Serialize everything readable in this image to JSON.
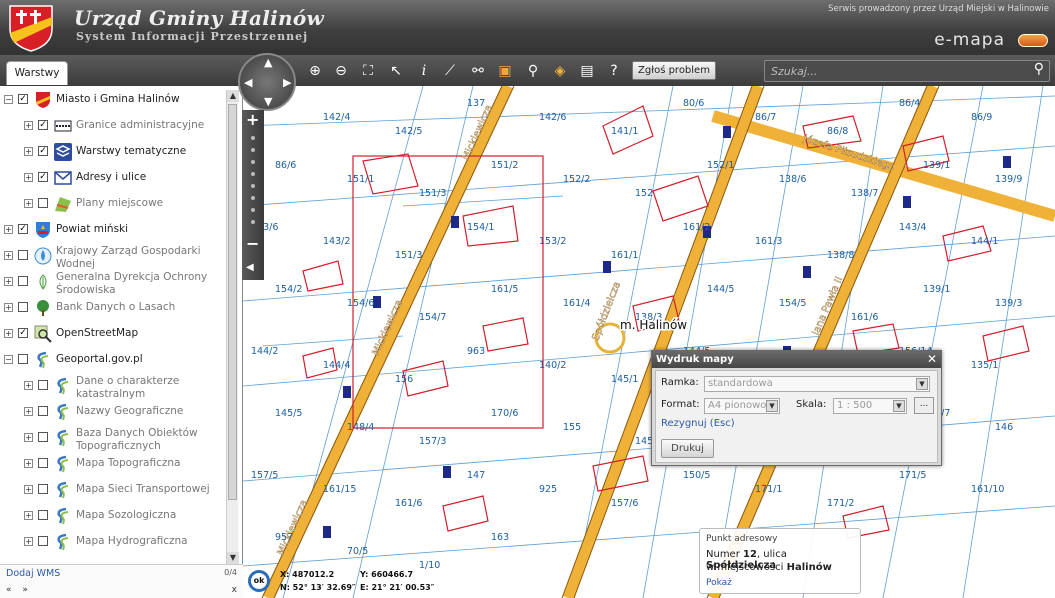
{
  "header": {
    "title": "Urząd Gminy Halinów",
    "subtitle": "System Informacji Przestrzennej",
    "service_note": "Serwis prowadzony przez Urząd Miejski w Halinowie",
    "brand": "e-mapa"
  },
  "toolbar": {
    "tab_label": "Warstwy",
    "report_button": "Zgłoś problem",
    "search_placeholder": "Szukaj..."
  },
  "sidebar": {
    "layers": [
      {
        "label": "Miasto i Gmina Halinów",
        "checked": true,
        "expand": "−",
        "indent": 0,
        "icon": "crest-icon",
        "dim": false
      },
      {
        "label": "Granice administracyjne",
        "checked": true,
        "expand": "+",
        "indent": 1,
        "icon": "boundary-icon",
        "dim": true
      },
      {
        "label": "Warstwy tematyczne",
        "checked": true,
        "expand": "+",
        "indent": 1,
        "icon": "layers-icon",
        "dim": false
      },
      {
        "label": "Adresy i ulice",
        "checked": true,
        "expand": "+",
        "indent": 1,
        "icon": "envelope-icon",
        "dim": false
      },
      {
        "label": "Plany miejscowe",
        "checked": false,
        "expand": "+",
        "indent": 1,
        "icon": "plan-icon",
        "dim": true
      },
      {
        "label": "Powiat miński",
        "checked": true,
        "expand": "+",
        "indent": 0,
        "icon": "county-crest-icon",
        "dim": false
      },
      {
        "label": "Krajowy Zarząd Gospodarki Wodnej",
        "checked": false,
        "expand": "+",
        "indent": 0,
        "icon": "water-icon",
        "dim": true
      },
      {
        "label": "Generalna Dyrekcja Ochrony Środowiska",
        "checked": false,
        "expand": "+",
        "indent": 0,
        "icon": "leaf-icon",
        "dim": true
      },
      {
        "label": "Bank Danych o Lasach",
        "checked": false,
        "expand": "+",
        "indent": 0,
        "icon": "tree-icon",
        "dim": true
      },
      {
        "label": "OpenStreetMap",
        "checked": true,
        "expand": "+",
        "indent": 0,
        "icon": "magnifier-map-icon",
        "dim": false
      },
      {
        "label": "Geoportal.gov.pl",
        "checked": false,
        "expand": "−",
        "indent": 0,
        "icon": "geoportal-icon",
        "dim": false
      },
      {
        "label": "Dane o charakterze katastralnym",
        "checked": false,
        "expand": "+",
        "indent": 1,
        "icon": "geoportal-icon",
        "dim": true
      },
      {
        "label": "Nazwy Geograficzne",
        "checked": false,
        "expand": "+",
        "indent": 1,
        "icon": "geoportal-icon",
        "dim": true
      },
      {
        "label": "Baza Danych Obiektów Topograficznych",
        "checked": false,
        "expand": "+",
        "indent": 1,
        "icon": "geoportal-icon",
        "dim": true
      },
      {
        "label": "Mapa Topograficzna",
        "checked": false,
        "expand": "+",
        "indent": 1,
        "icon": "geoportal-icon",
        "dim": true
      },
      {
        "label": "Mapa Sieci Transportowej",
        "checked": false,
        "expand": "+",
        "indent": 1,
        "icon": "geoportal-icon",
        "dim": true
      },
      {
        "label": "Mapa Sozologiczna",
        "checked": false,
        "expand": "+",
        "indent": 1,
        "icon": "geoportal-icon",
        "dim": true
      },
      {
        "label": "Mapa Hydrograficzna",
        "checked": false,
        "expand": "+",
        "indent": 1,
        "icon": "geoportal-icon",
        "dim": true
      }
    ],
    "add_wms": "Dodaj WMS",
    "wms_count": "0/4",
    "pager": "« »",
    "pager_close": "x"
  },
  "map": {
    "streets": [
      "Mickiewicza",
      "Mickiewicza",
      "Mickiewicza",
      "Józefa Piłsudskiego",
      "Spółdzielcza",
      "Jana Pawła II"
    ],
    "place_label": "m. Halinów",
    "parcels": [
      "136/3",
      "142/4",
      "142/5",
      "137",
      "142/6",
      "141/1",
      "80/6",
      "86/7",
      "86/8",
      "86/4",
      "86/9",
      "86/6",
      "151/1",
      "151/3",
      "151/2",
      "152/2",
      "152",
      "152/1",
      "138/6",
      "138/7",
      "139/1",
      "139/9",
      "143/6",
      "143/2",
      "151/3",
      "154/1",
      "153/2",
      "161/1",
      "161/2",
      "161/3",
      "138/8",
      "143/4",
      "144/1",
      "154/2",
      "154/6",
      "154/7",
      "161/5",
      "161/4",
      "138/3",
      "144/5",
      "154/5",
      "161/6",
      "139/1",
      "139/3",
      "144/2",
      "144/4",
      "156",
      "963",
      "140/2",
      "145/1",
      "144/5",
      "145/3",
      "145/2",
      "156/14",
      "135/1",
      "145/5",
      "148/4",
      "157/3",
      "170/6",
      "155",
      "145/6",
      "157/4",
      "161/14",
      "161/13",
      "170/7",
      "146",
      "157/5",
      "161/15",
      "161/6",
      "147",
      "925",
      "157/6",
      "150/5",
      "171/1",
      "171/2",
      "171/5",
      "161/10",
      "957",
      "70/5",
      "1/10",
      "163"
    ],
    "coords_x": "X: 487012.2",
    "coords_y": "Y: 660466.7",
    "coords_n": "N: 52° 13′ 32.69″",
    "coords_e": "E: 21° 21′ 00.53″",
    "ok_label": "ok"
  },
  "print_dialog": {
    "title": "Wydruk mapy",
    "frame_label": "Ramka:",
    "frame_value": "standardowa",
    "format_label": "Format:",
    "format_value": "A4 pionowo",
    "scale_label": "Skala:",
    "scale_value": "1 : 500",
    "more_button": "...",
    "cancel_link": "Rezygnuj (Esc)",
    "print_button": "Drukuj"
  },
  "address_popup": {
    "title": "Punkt adresowy",
    "line1_prefix": "Numer ",
    "number": "12",
    "line1_mid": ", ulica ",
    "street": "Spółdzielcza",
    "line2_prefix": "w miejscowości ",
    "town": "Halinów",
    "link": "Pokaż"
  }
}
